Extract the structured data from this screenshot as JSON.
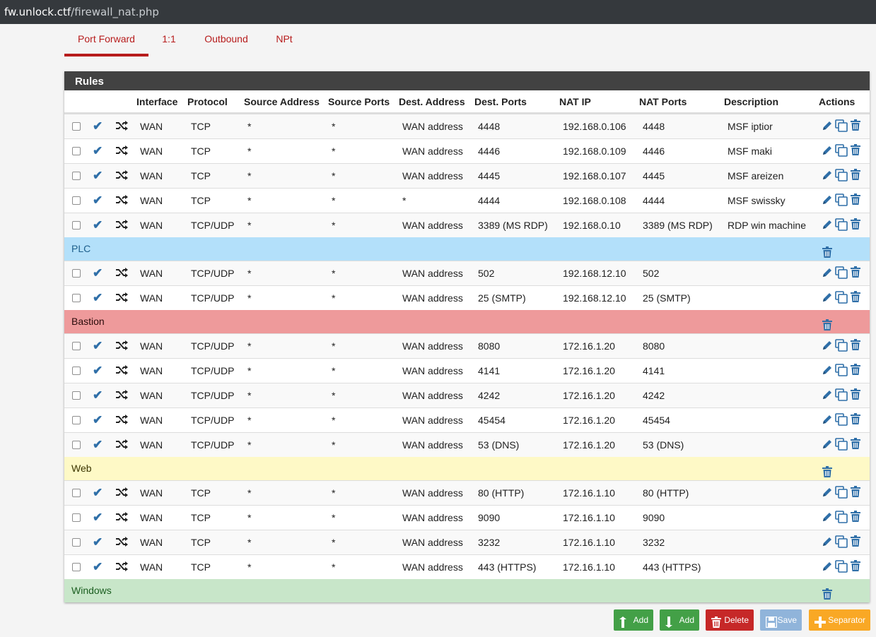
{
  "url": {
    "host": "fw.unlock.ctf",
    "path": "/firewall_nat.php"
  },
  "tabs": [
    "Port Forward",
    "1:1",
    "Outbound",
    "NPt"
  ],
  "active_tab": "Port Forward",
  "panel_title": "Rules",
  "columns": [
    "Interface",
    "Protocol",
    "Source Address",
    "Source Ports",
    "Dest. Address",
    "Dest. Ports",
    "NAT IP",
    "NAT Ports",
    "Description",
    "Actions"
  ],
  "rules_top": [
    {
      "iface": "WAN",
      "proto": "TCP",
      "src": "*",
      "sport": "*",
      "dst": "WAN address",
      "dport": "4448",
      "natip": "192.168.0.106",
      "natport": "4448",
      "desc": "MSF iptior"
    },
    {
      "iface": "WAN",
      "proto": "TCP",
      "src": "*",
      "sport": "*",
      "dst": "WAN address",
      "dport": "4446",
      "natip": "192.168.0.109",
      "natport": "4446",
      "desc": "MSF maki"
    },
    {
      "iface": "WAN",
      "proto": "TCP",
      "src": "*",
      "sport": "*",
      "dst": "WAN address",
      "dport": "4445",
      "natip": "192.168.0.107",
      "natport": "4445",
      "desc": "MSF areizen"
    },
    {
      "iface": "WAN",
      "proto": "TCP",
      "src": "*",
      "sport": "*",
      "dst": "*",
      "dport": "4444",
      "natip": "192.168.0.108",
      "natport": "4444",
      "desc": "MSF swissky"
    },
    {
      "iface": "WAN",
      "proto": "TCP/UDP",
      "src": "*",
      "sport": "*",
      "dst": "WAN address",
      "dport": "3389 (MS RDP)",
      "natip": "192.168.0.10",
      "natport": "3389 (MS RDP)",
      "desc": "RDP win machine"
    }
  ],
  "groups": [
    {
      "name": "PLC",
      "color": "#b3e0fa",
      "text_color": "#1e5f8c",
      "rules": [
        {
          "iface": "WAN",
          "proto": "TCP/UDP",
          "src": "*",
          "sport": "*",
          "dst": "WAN address",
          "dport": "502",
          "natip": "192.168.12.10",
          "natport": "502",
          "desc": ""
        },
        {
          "iface": "WAN",
          "proto": "TCP/UDP",
          "src": "*",
          "sport": "*",
          "dst": "WAN address",
          "dport": "25 (SMTP)",
          "natip": "192.168.12.10",
          "natport": "25 (SMTP)",
          "desc": ""
        }
      ]
    },
    {
      "name": "Bastion",
      "color": "#ee9a9b",
      "text_color": "#2a0b0b",
      "rules": [
        {
          "iface": "WAN",
          "proto": "TCP/UDP",
          "src": "*",
          "sport": "*",
          "dst": "WAN address",
          "dport": "8080",
          "natip": "172.16.1.20",
          "natport": "8080",
          "desc": ""
        },
        {
          "iface": "WAN",
          "proto": "TCP/UDP",
          "src": "*",
          "sport": "*",
          "dst": "WAN address",
          "dport": "4141",
          "natip": "172.16.1.20",
          "natport": "4141",
          "desc": ""
        },
        {
          "iface": "WAN",
          "proto": "TCP/UDP",
          "src": "*",
          "sport": "*",
          "dst": "WAN address",
          "dport": "4242",
          "natip": "172.16.1.20",
          "natport": "4242",
          "desc": ""
        },
        {
          "iface": "WAN",
          "proto": "TCP/UDP",
          "src": "*",
          "sport": "*",
          "dst": "WAN address",
          "dport": "45454",
          "natip": "172.16.1.20",
          "natport": "45454",
          "desc": ""
        },
        {
          "iface": "WAN",
          "proto": "TCP/UDP",
          "src": "*",
          "sport": "*",
          "dst": "WAN address",
          "dport": "53 (DNS)",
          "natip": "172.16.1.20",
          "natport": "53 (DNS)",
          "desc": ""
        }
      ]
    },
    {
      "name": "Web",
      "color": "#fef9c6",
      "text_color": "#3b3500",
      "rules": [
        {
          "iface": "WAN",
          "proto": "TCP",
          "src": "*",
          "sport": "*",
          "dst": "WAN address",
          "dport": "80 (HTTP)",
          "natip": "172.16.1.10",
          "natport": "80 (HTTP)",
          "desc": ""
        },
        {
          "iface": "WAN",
          "proto": "TCP",
          "src": "*",
          "sport": "*",
          "dst": "WAN address",
          "dport": "9090",
          "natip": "172.16.1.10",
          "natport": "9090",
          "desc": ""
        },
        {
          "iface": "WAN",
          "proto": "TCP",
          "src": "*",
          "sport": "*",
          "dst": "WAN address",
          "dport": "3232",
          "natip": "172.16.1.10",
          "natport": "3232",
          "desc": ""
        },
        {
          "iface": "WAN",
          "proto": "TCP",
          "src": "*",
          "sport": "*",
          "dst": "WAN address",
          "dport": "443 (HTTPS)",
          "natip": "172.16.1.10",
          "natport": "443 (HTTPS)",
          "desc": ""
        }
      ]
    },
    {
      "name": "Windows",
      "color": "#c8e6c9",
      "text_color": "#1b5e20",
      "rules": []
    }
  ],
  "buttons": [
    {
      "name": "add-top-button",
      "label": "Add",
      "color": "#43a047",
      "icon": "arrow-up-icon"
    },
    {
      "name": "add-bottom-button",
      "label": "Add",
      "color": "#43a047",
      "icon": "arrow-down-icon"
    },
    {
      "name": "delete-button",
      "label": "Delete",
      "color": "#c62828",
      "icon": "trash-icon"
    },
    {
      "name": "save-button",
      "label": "Save",
      "color": "#90b4da",
      "icon": "floppy-disk-icon"
    },
    {
      "name": "separator-button",
      "label": "Separator",
      "color": "#f9a825",
      "icon": "plus-icon"
    }
  ],
  "colors": {
    "accent": "#b71c1c",
    "icon_blue": "#2f6fa8",
    "header_dark": "#424242"
  },
  "icons": {
    "enabled": "check-icon",
    "nat": "shuffle-icon",
    "edit": "pencil-icon",
    "copy": "copy-icon",
    "delete": "trash-icon"
  }
}
